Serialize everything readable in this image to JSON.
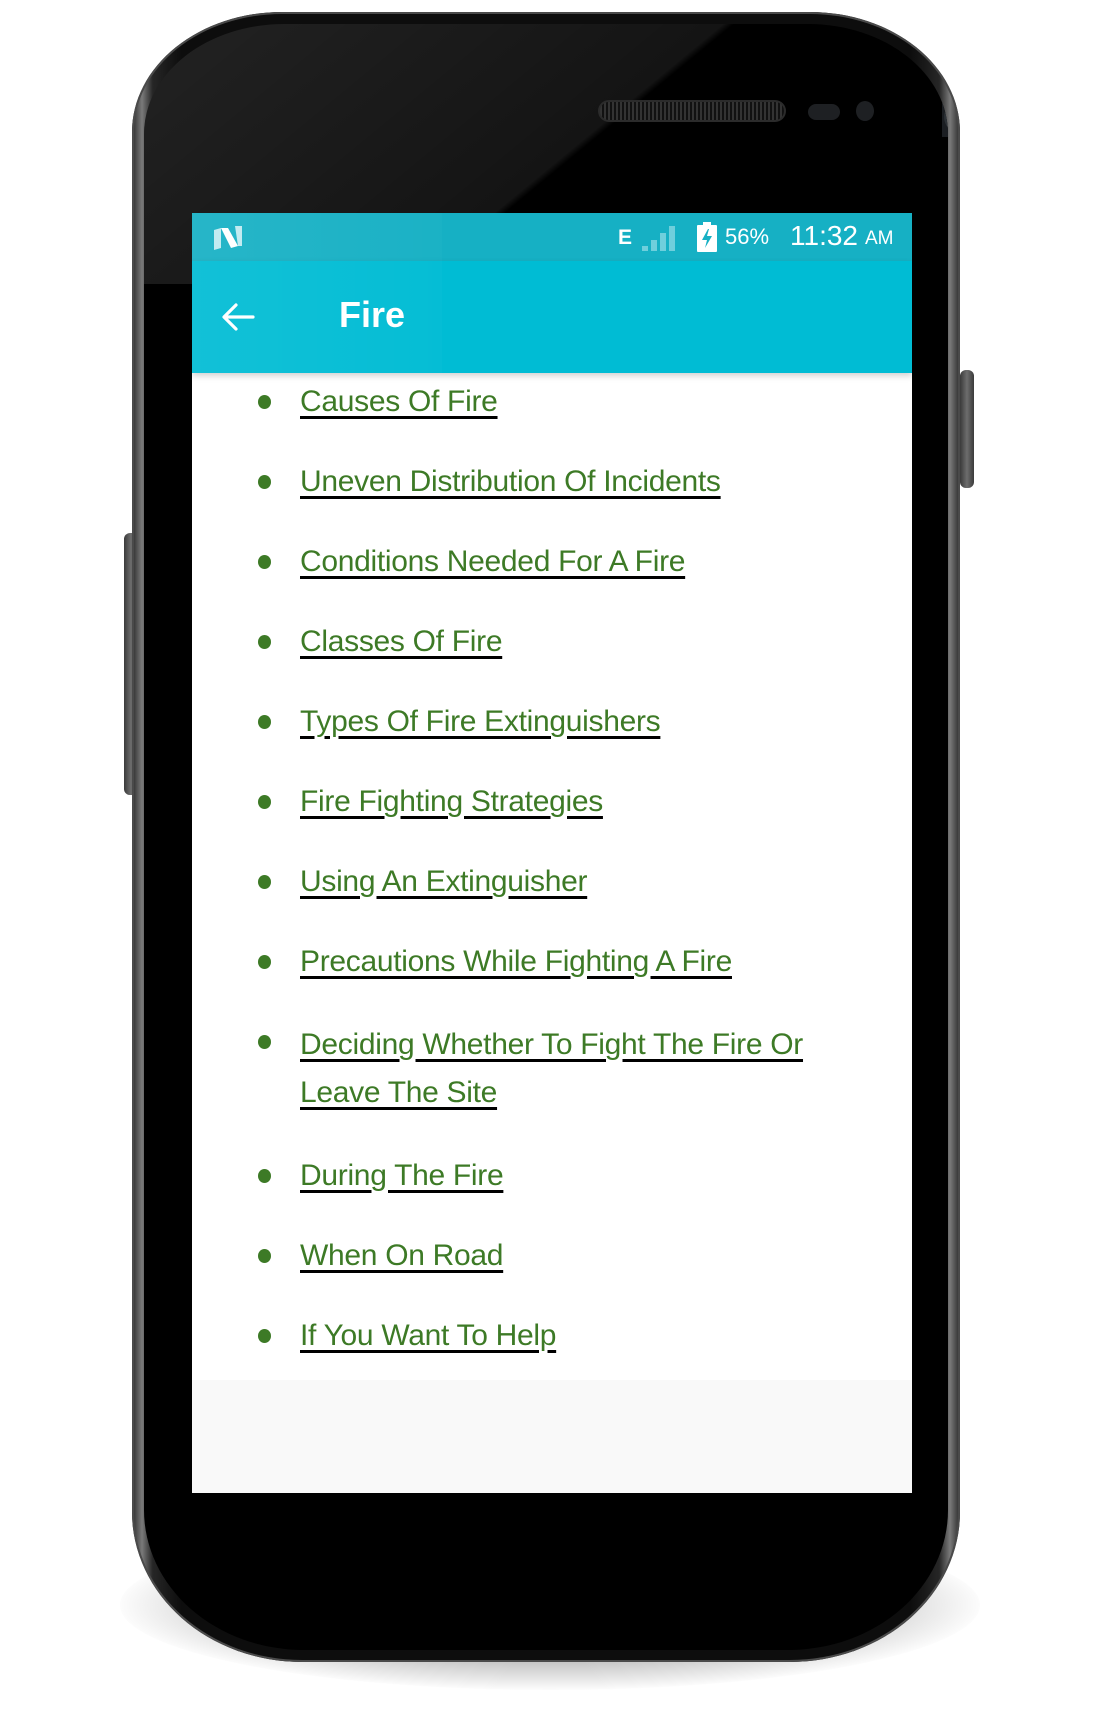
{
  "status_bar": {
    "notification_icon": "android-n-logo",
    "network_type": "E",
    "signal_icon": "cell-signal-icon",
    "battery_icon": "battery-charging-icon",
    "battery_percent": "56%",
    "time": "11:32",
    "ampm": "AM"
  },
  "app_bar": {
    "back_icon": "arrow-left-icon",
    "title": "Fire"
  },
  "topics": [
    {
      "label": "Causes Of Fire"
    },
    {
      "label": "Uneven Distribution Of Incidents"
    },
    {
      "label": "Conditions Needed For A Fire"
    },
    {
      "label": "Classes Of Fire"
    },
    {
      "label": "Types Of Fire Extinguishers"
    },
    {
      "label": "Fire Fighting Strategies"
    },
    {
      "label": "Using An Extinguisher"
    },
    {
      "label": "Precautions While Fighting A Fire"
    },
    {
      "label": "Deciding Whether To Fight The Fire Or Leave The Site"
    },
    {
      "label": "During The Fire"
    },
    {
      "label": "When On Road"
    },
    {
      "label": "If You Want To Help"
    }
  ],
  "colors": {
    "status_bar": "#16b0c4",
    "app_bar": "#00bcd4",
    "link_text": "#3d7a26",
    "underline": "#000000",
    "content_bg": "#ffffff",
    "footer_bg": "#f9f9f9"
  }
}
